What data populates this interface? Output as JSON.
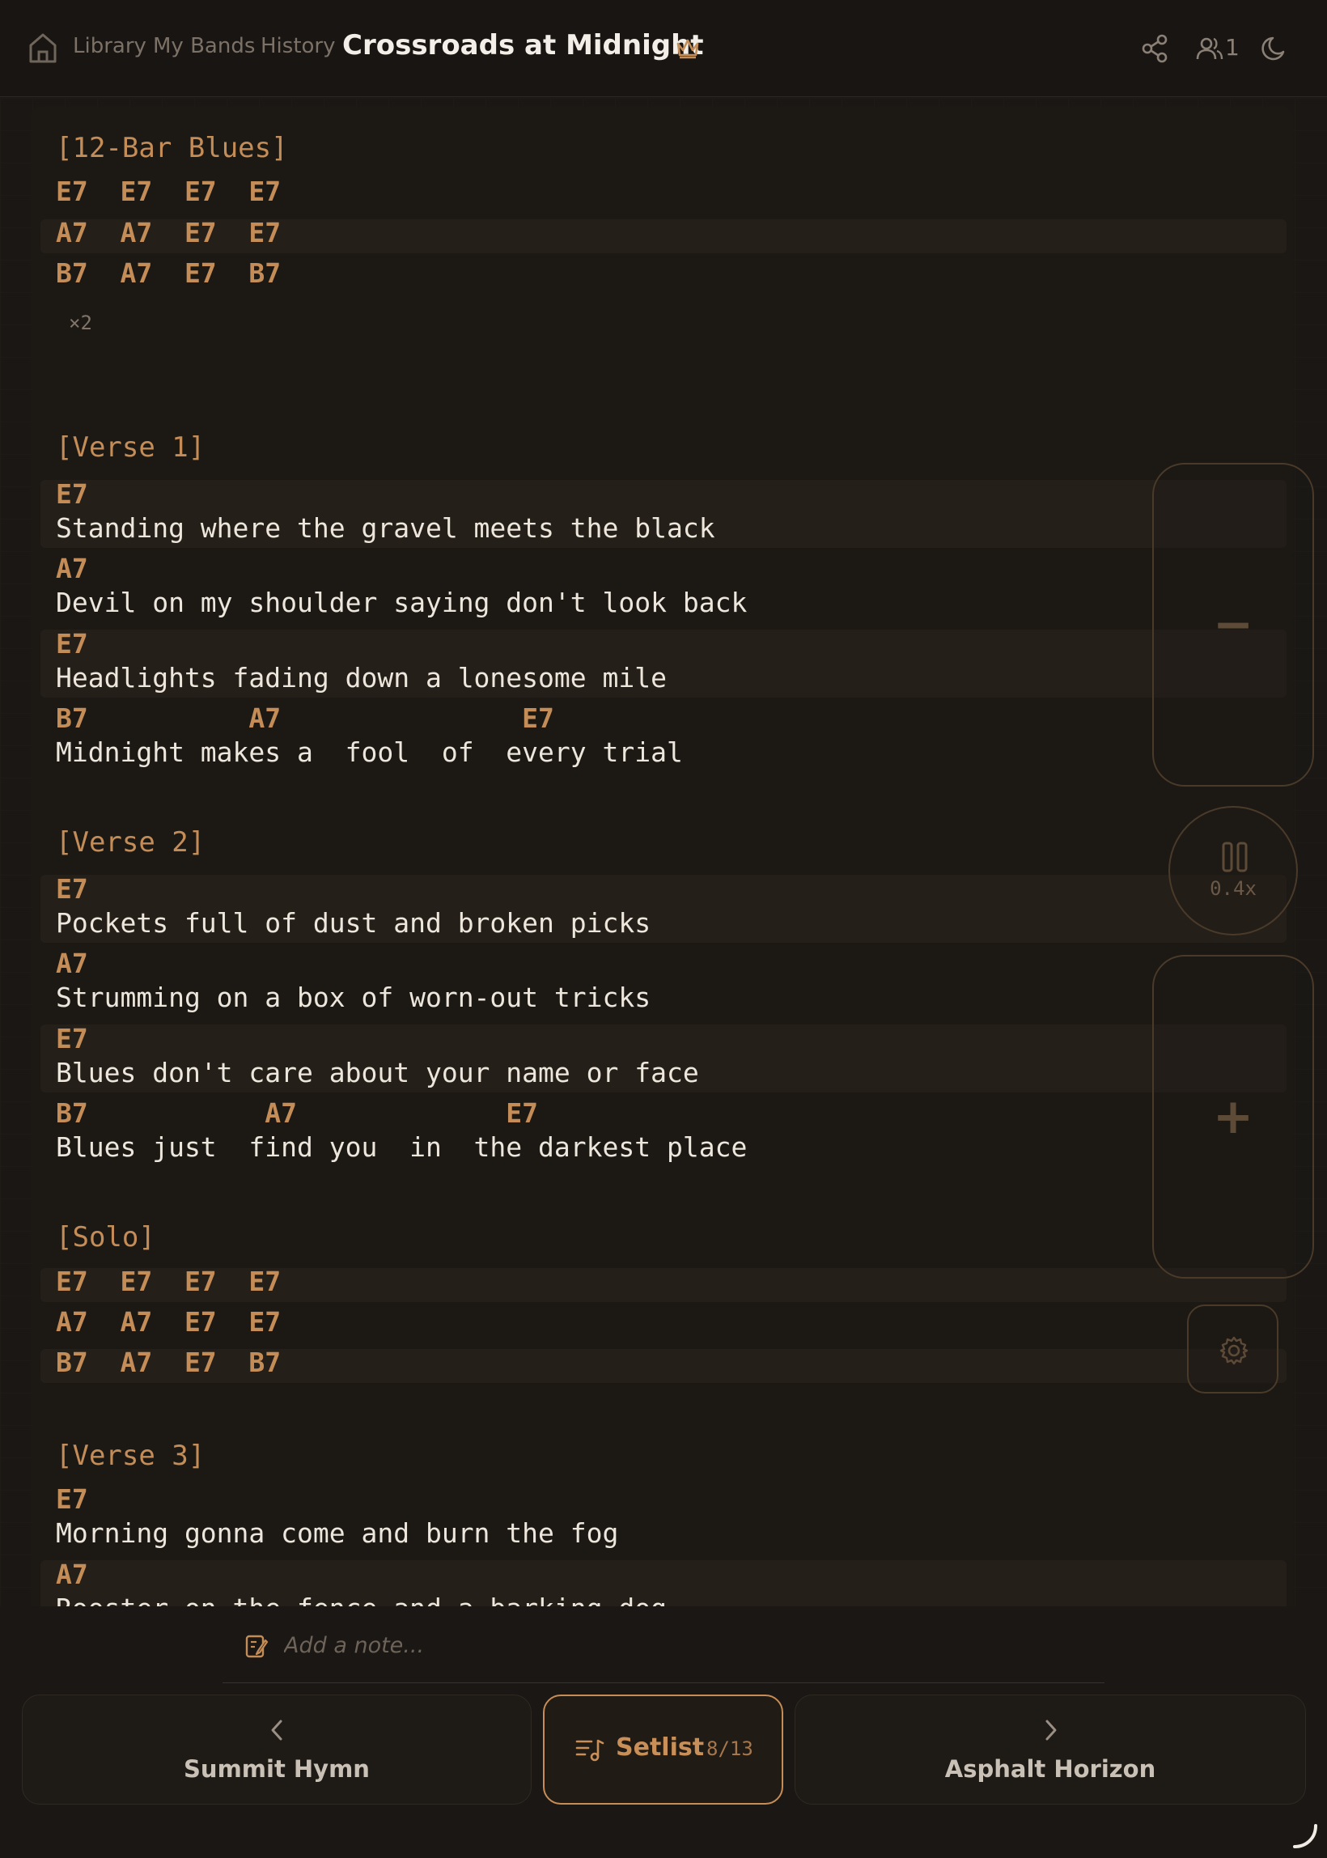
{
  "header": {
    "nav": [
      "Library",
      "My Bands",
      "History"
    ],
    "title": "Crossroads at Midnight",
    "users_count": "1"
  },
  "sheet": {
    "intro": {
      "label": "[12-Bar Blues]",
      "rows": [
        "E7  E7  E7  E7",
        "A7  A7  E7  E7",
        "B7  A7  E7  B7"
      ],
      "repeat": "×2"
    },
    "verse1": {
      "label": "[Verse 1]",
      "lines": [
        {
          "chords": "E7",
          "lyric": "Standing where the gravel meets the black"
        },
        {
          "chords": "A7",
          "lyric": "Devil on my shoulder saying don't look back"
        },
        {
          "chords": "E7",
          "lyric": "Headlights fading down a lonesome mile"
        },
        {
          "chords": "B7          A7               E7",
          "lyric": "Midnight makes a  fool  of  every trial"
        }
      ]
    },
    "verse2": {
      "label": "[Verse 2]",
      "lines": [
        {
          "chords": "E7",
          "lyric": "Pockets full of dust and broken picks"
        },
        {
          "chords": "A7",
          "lyric": "Strumming on a box of worn-out tricks"
        },
        {
          "chords": "E7",
          "lyric": "Blues don't care about your name or face"
        },
        {
          "chords": "B7           A7             E7",
          "lyric": "Blues just  find you  in  the darkest place"
        }
      ]
    },
    "solo": {
      "label": "[Solo]",
      "rows": [
        "E7  E7  E7  E7",
        "A7  A7  E7  E7",
        "B7  A7  E7  B7"
      ]
    },
    "verse3": {
      "label": "[Verse 3]",
      "lines": [
        {
          "chords": "E7",
          "lyric": "Morning gonna come and burn the fog"
        },
        {
          "chords": "A7",
          "lyric": "Rooster on the fence and a barking dog"
        }
      ]
    }
  },
  "controls": {
    "decrease_label": "−",
    "increase_label": "+",
    "speed": "0.4x"
  },
  "footer": {
    "note_placeholder": "Add a note...",
    "prev_song": "Summit Hymn",
    "next_song": "Asphalt Horizon",
    "setlist_label": "Setlist",
    "setlist_position": "8/13"
  },
  "colors": {
    "accent": "#c48c57",
    "background": "#1a1714",
    "lyric_text": "#ece6dc",
    "highlight_row": "#251f19"
  },
  "icons": [
    "home-icon",
    "crown-icon",
    "share-icon",
    "users-icon",
    "moon-icon",
    "pause-icon",
    "gear-icon",
    "note-icon",
    "chevron-left-icon",
    "chevron-right-icon",
    "setlist-icon",
    "resize-handle-icon"
  ]
}
